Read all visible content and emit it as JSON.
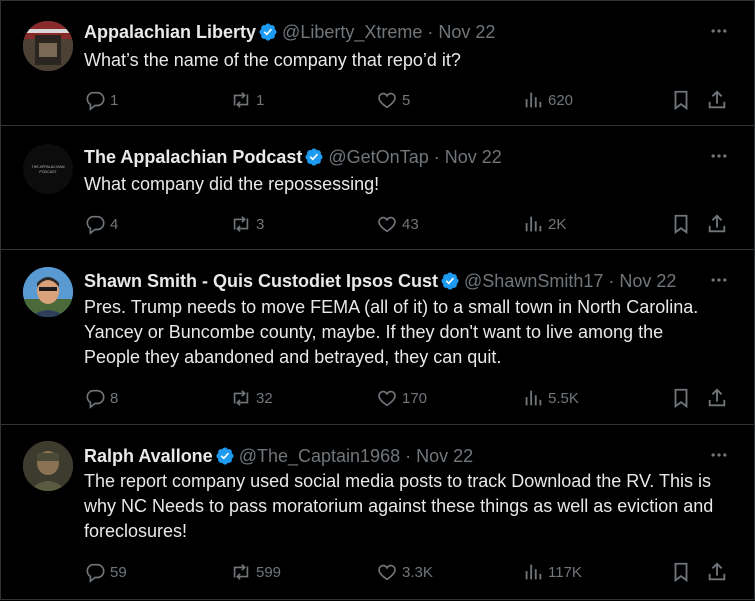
{
  "tweets": [
    {
      "name": "Appalachian Liberty",
      "handle": "@Liberty_Xtreme",
      "dot": "·",
      "date": "Nov 22",
      "text": "What’s the name of the company that repo’d it?",
      "replies": "1",
      "reposts": "1",
      "likes": "5",
      "views": "620"
    },
    {
      "name": "The Appalachian Podcast",
      "handle": "@GetOnTap",
      "dot": "·",
      "date": "Nov 22",
      "avatar_text": "THE APPALACHIAN PODCAST",
      "text": "What company did the repossessing!",
      "replies": "4",
      "reposts": "3",
      "likes": "43",
      "views": "2K"
    },
    {
      "name": "Shawn Smith - Quis Custodiet Ipsos Cust",
      "handle": "@ShawnSmith17",
      "dot": "·",
      "date": "Nov 22",
      "text": "Pres. Trump needs to move FEMA (all of it) to a small town in North Carolina.  Yancey or Buncombe county, maybe.  If they don't want to live among the People they abandoned and betrayed, they can quit.",
      "replies": "8",
      "reposts": "32",
      "likes": "170",
      "views": "5.5K"
    },
    {
      "name": "Ralph Avallone",
      "handle": "@The_Captain1968",
      "dot": "·",
      "date": "Nov 22",
      "text": "The report company used social media posts to track Download the RV. This is why NC Needs to pass moratorium against these things as well as eviction and foreclosures!",
      "replies": "59",
      "reposts": "599",
      "likes": "3.3K",
      "views": "117K"
    }
  ],
  "icons": {
    "reply": "reply-icon",
    "repost": "repost-icon",
    "like": "heart-icon",
    "views": "views-icon",
    "bookmark": "bookmark-icon",
    "share": "share-icon",
    "more": "more-icon",
    "verified": "verified-badge-icon"
  },
  "colors": {
    "background": "#000000",
    "text": "#e7e9ea",
    "muted": "#71767b",
    "verified": "#1d9bf0",
    "divider": "#2f3336"
  }
}
